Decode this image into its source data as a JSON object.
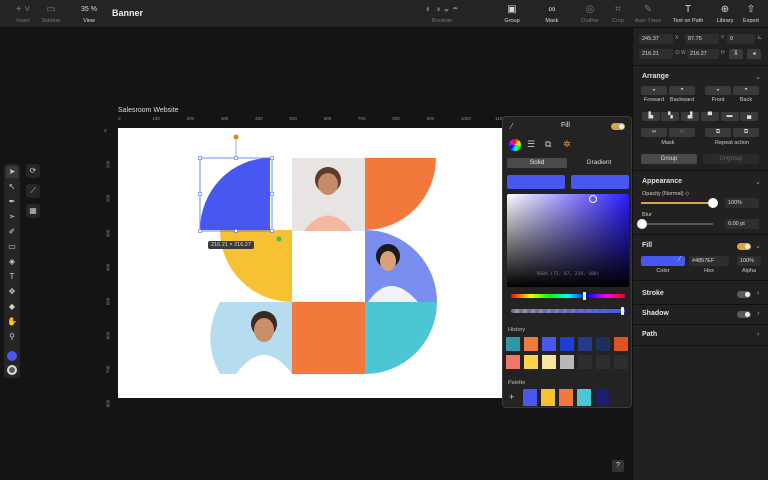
{
  "toolbar": {
    "insert": "Insert",
    "sidebar": "Sidebar",
    "view": "View",
    "zoom": "35 %",
    "document_title": "Banner",
    "boolean": "Boolean",
    "group": "Group",
    "mask": "Mask",
    "outline": "Outline",
    "crop": "Crop",
    "auto_trace": "Auto Trace",
    "text_on_path": "Text on Path",
    "library": "Library",
    "export": "Export"
  },
  "canvas": {
    "artboard_name": "Salesroom Website",
    "ruler_h_ticks": [
      "0",
      "100",
      "200",
      "300",
      "400",
      "500",
      "600",
      "700",
      "800",
      "900",
      "1000",
      "1100"
    ],
    "ruler_v_ticks": [
      "0",
      "100",
      "200",
      "300",
      "400",
      "500",
      "600",
      "700",
      "800"
    ],
    "selection_size": "216.21 × 216.27",
    "help_label": "?"
  },
  "fill_popover": {
    "title": "Fill",
    "tab_solid": "Solid",
    "tab_gradient": "Gradient",
    "rgba_text": "RGBA (72, 87, 239, 100)",
    "history_label": "History",
    "palette_label": "Palette",
    "add_label": "+",
    "history_colors": [
      "#2f96a6",
      "#f2793b",
      "#4857ef",
      "#1e3ecf",
      "#243b8c",
      "#1f2f5c",
      "#e0531e",
      "#f0776a",
      "#f9d34a",
      "#f7e79b",
      "#b8b8b8",
      "#ffffff",
      "#ffffff",
      "#ffffff"
    ],
    "palette_colors": [
      "#4857ef",
      "#f6c133",
      "#f2793b",
      "#4bc6d4",
      "#1a1f6b"
    ]
  },
  "inspector": {
    "x_value": "245.37",
    "x_label": "X",
    "y_value": "87.75",
    "y_label": "Y",
    "rotation_value": "0",
    "w_value": "216.21",
    "w_label": "W",
    "h_value": "216.27",
    "h_label": "H",
    "arrange": {
      "title": "Arrange",
      "forward": "Forward",
      "backward": "Backward",
      "front": "Front",
      "back": "Back",
      "mask": "Mask",
      "repeat": "Repeat action",
      "group": "Group",
      "ungroup": "Ungroup"
    },
    "appearance": {
      "title": "Appearance",
      "opacity_label": "Opacity (Normal) ◇",
      "opacity_value": "100%",
      "opacity": 1.0,
      "blur_label": "Blur",
      "blur_value": "0.00 pt",
      "blur": 0.0
    },
    "fill": {
      "title": "Fill",
      "hex": "#4857EF",
      "alpha": "100%",
      "color_label": "Color",
      "hex_label": "Hex",
      "alpha_label": "Alpha",
      "color": "#4857ef"
    },
    "stroke": {
      "title": "Stroke"
    },
    "shadow": {
      "title": "Shadow"
    },
    "path": {
      "title": "Path"
    }
  },
  "colors": {
    "blue": "#4857ef",
    "orange": "#f2793b",
    "yellow": "#f6c133",
    "cyan": "#4bc6d4",
    "toggle_on": "#d9a441"
  }
}
